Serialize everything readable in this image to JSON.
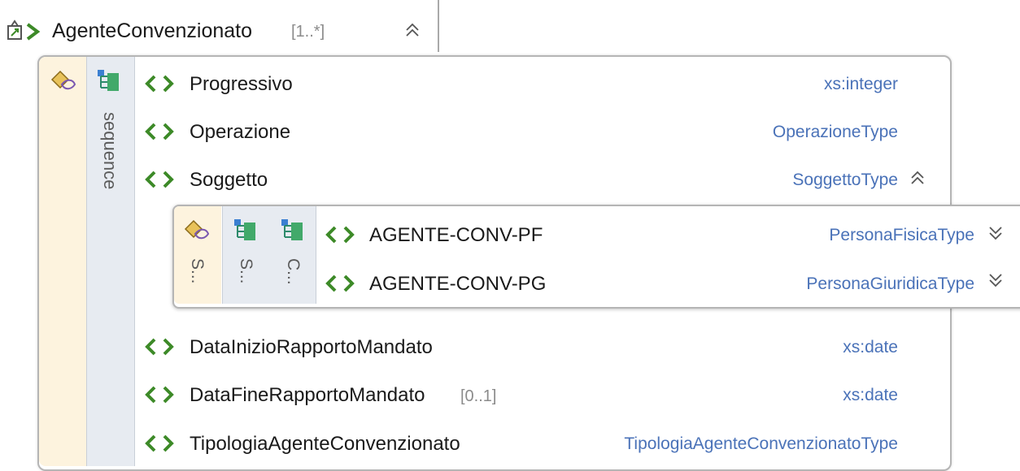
{
  "header": {
    "name": "AgenteConvenzionato",
    "cardinality": "[1..*]"
  },
  "sequence_label": "sequence",
  "rows": [
    {
      "name": "Progressivo",
      "type": "xs:integer"
    },
    {
      "name": "Operazione",
      "type": "OperazioneType"
    },
    {
      "name": "Soggetto",
      "type": "SoggettoType"
    },
    {
      "name": "DataInizioRapportoMandato",
      "type": "xs:date"
    },
    {
      "name": "DataFineRapportoMandato",
      "cardinality": "[0..1]",
      "type": "xs:date"
    },
    {
      "name": "TipologiaAgenteConvenzionato",
      "type": "TipologiaAgenteConvenzionatoType"
    }
  ],
  "choice": {
    "labels": [
      "S...",
      "S...",
      "C..."
    ],
    "items": [
      {
        "name": "AGENTE-CONV-PF",
        "type": "PersonaFisicaType"
      },
      {
        "name": "AGENTE-CONV-PG",
        "type": "PersonaGiuridicaType"
      }
    ]
  },
  "colors": {
    "element_icon": "#3d8a28",
    "type_text": "#4a72b8",
    "attr_bg": "#fdf3de",
    "group_bg": "#e7ebf1"
  },
  "icons": [
    "element-root-icon",
    "attributes-icon",
    "sequence-icon",
    "choice-icon",
    "element-icon",
    "collapse-icon",
    "expand-icon"
  ]
}
